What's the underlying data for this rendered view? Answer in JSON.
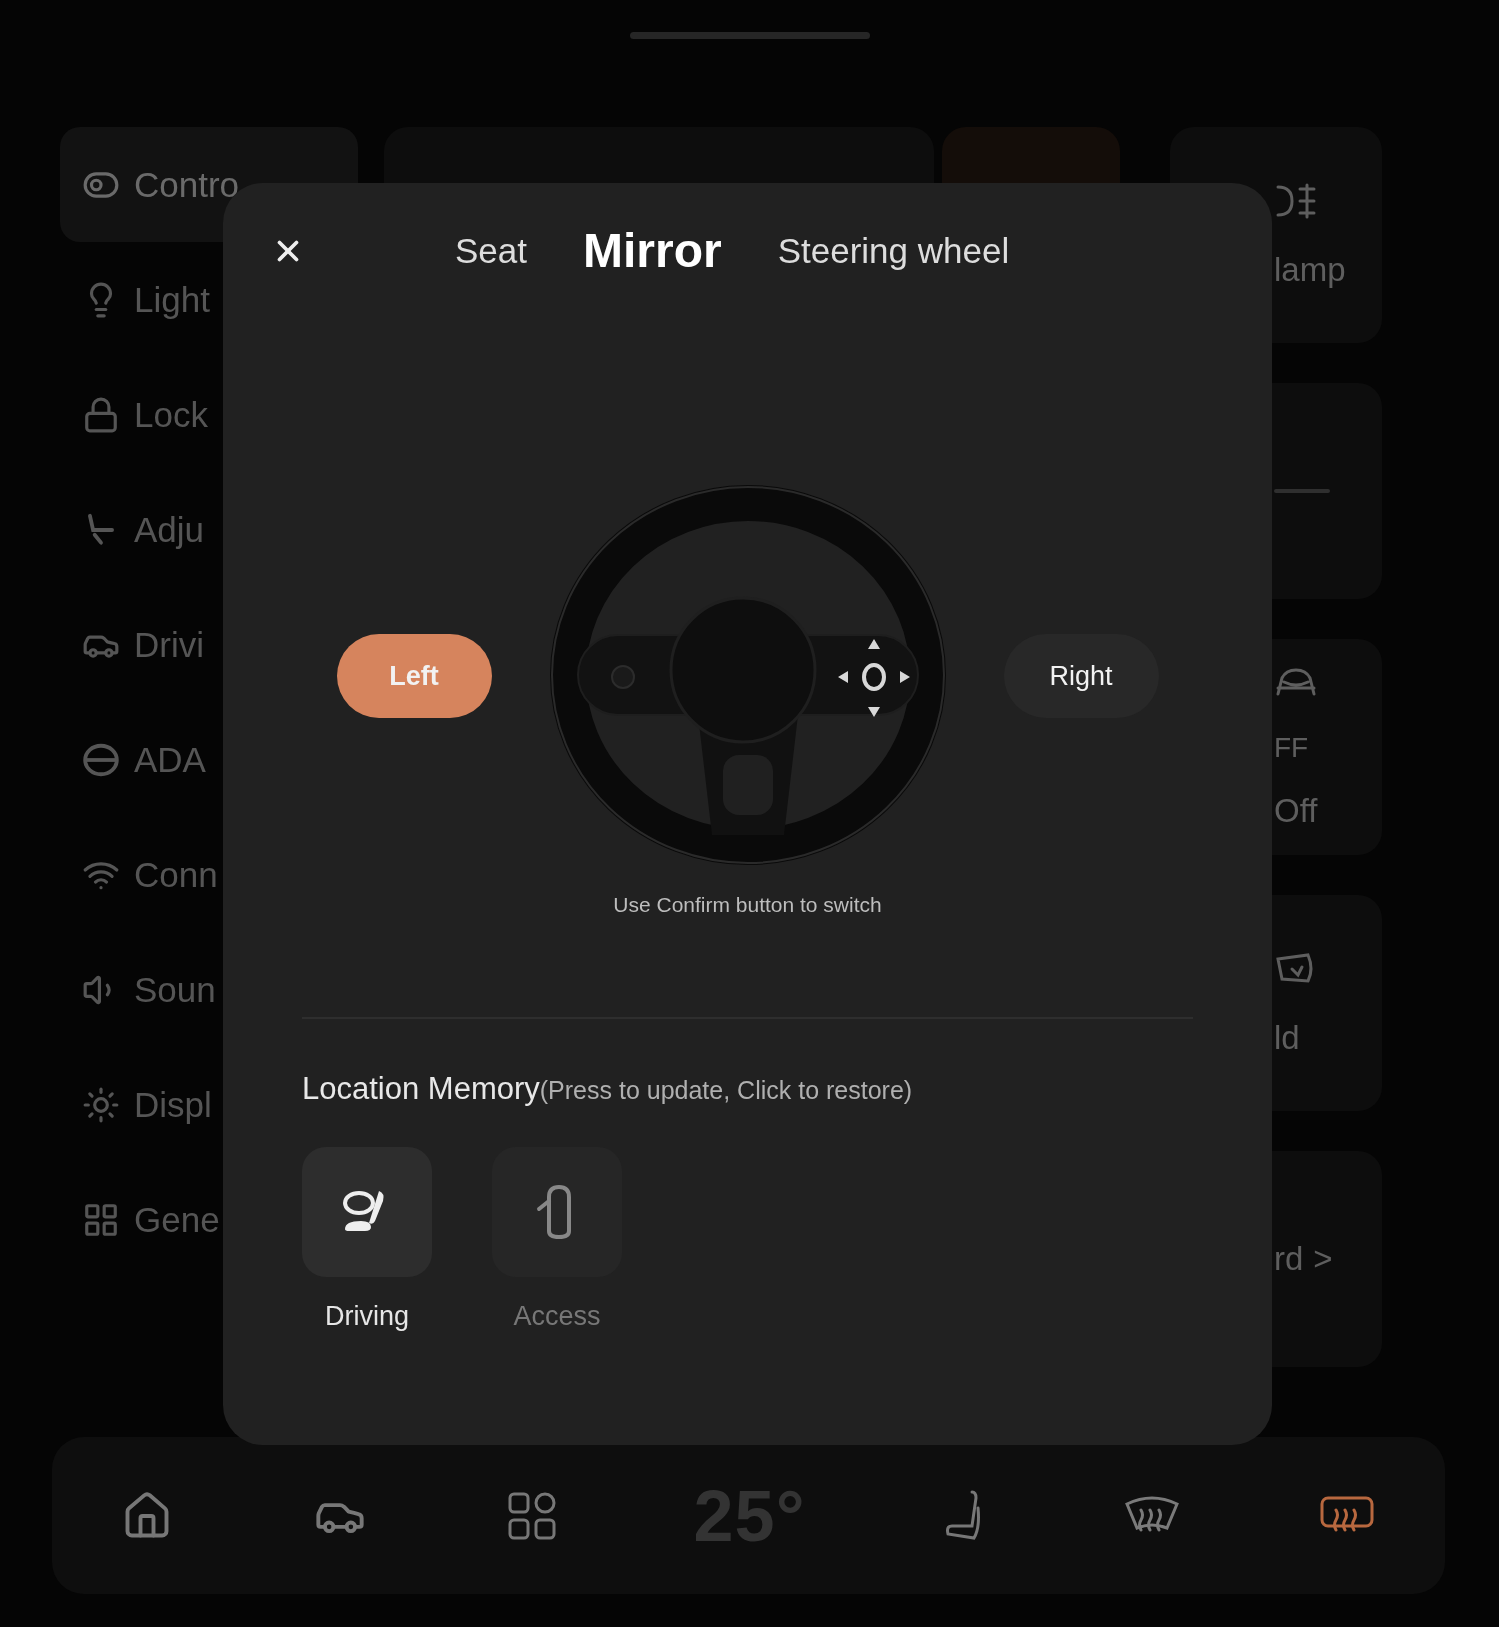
{
  "sidebar": {
    "items": [
      {
        "label": "Contro",
        "selected": true
      },
      {
        "label": "Light",
        "selected": false
      },
      {
        "label": "Lock",
        "selected": false
      },
      {
        "label": "Adju",
        "selected": false
      },
      {
        "label": "Drivi",
        "selected": false
      },
      {
        "label": "ADA",
        "selected": false
      },
      {
        "label": "Conn",
        "selected": false
      },
      {
        "label": "Soun",
        "selected": false
      },
      {
        "label": "Displ",
        "selected": false
      },
      {
        "label": "Gene",
        "selected": false
      }
    ]
  },
  "right_cards": [
    {
      "kind": "toggle",
      "label": "lamp"
    },
    {
      "kind": "slider"
    },
    {
      "kind": "toggle",
      "badge": "FF",
      "label": "Off"
    },
    {
      "kind": "toggle",
      "label": "ld"
    },
    {
      "kind": "link",
      "label": "rd",
      "chevron": ">"
    }
  ],
  "dialog": {
    "tabs": [
      {
        "label": "Seat",
        "selected": false
      },
      {
        "label": "Mirror",
        "selected": true
      },
      {
        "label": "Steering wheel",
        "selected": false
      }
    ],
    "sides": [
      {
        "label": "Left",
        "selected": true
      },
      {
        "label": "Right",
        "selected": false
      }
    ],
    "hint": "Use Confirm button to switch",
    "memory": {
      "title": "Location Memory",
      "note": "(Press to update, Click to restore)",
      "slots": [
        {
          "label": "Driving",
          "selected": true
        },
        {
          "label": "Access",
          "selected": false
        }
      ]
    }
  },
  "dock": {
    "temperature": "25°",
    "defrosters": [
      {
        "on": false
      },
      {
        "on": true
      }
    ]
  }
}
